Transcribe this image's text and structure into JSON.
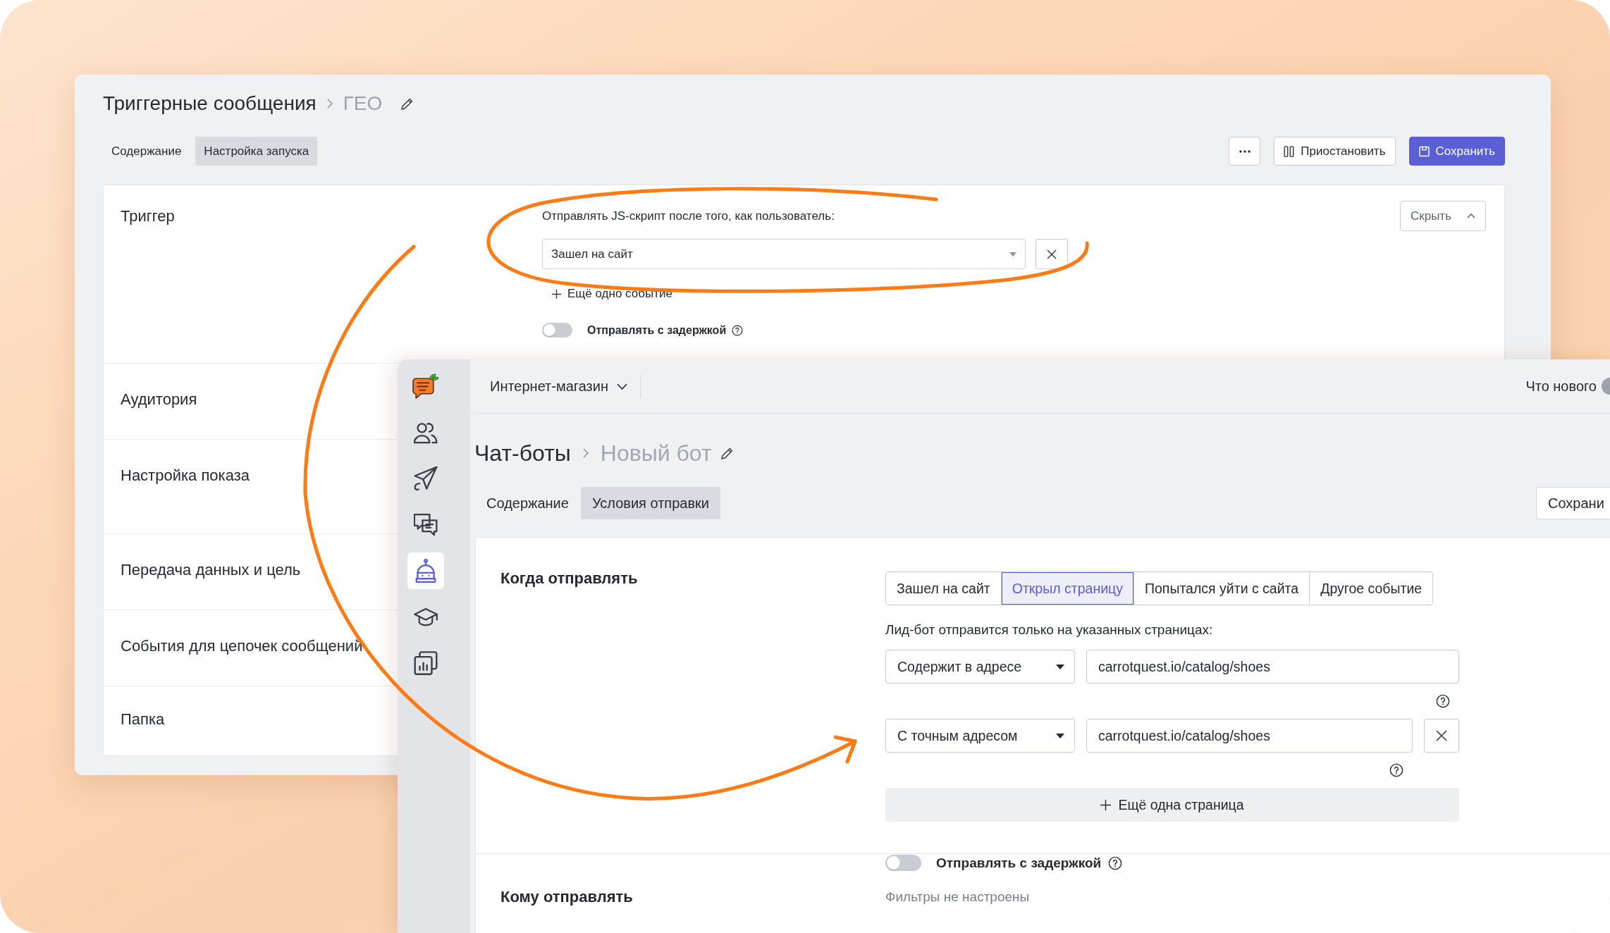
{
  "back_window": {
    "breadcrumb": {
      "parent": "Триггерные сообщения",
      "current": "ГЕО"
    },
    "tabs": [
      {
        "label": "Содержание",
        "selected": false
      },
      {
        "label": "Настройка запуска",
        "selected": true
      }
    ],
    "actions": [
      {
        "kind": "more"
      },
      {
        "kind": "pause",
        "label": "Приостановить"
      },
      {
        "kind": "save",
        "label": "Сохранить"
      }
    ],
    "sections": [
      {
        "kind": "trigger",
        "title": "Триггер",
        "prompt": "Отправлять JS-скрипт после того, как пользователь:",
        "event": "Зашел на сайт",
        "add_event": "Ещё одно событие",
        "delay_toggle": {
          "label": "Отправлять с задержкой",
          "on": false
        },
        "hide_button": "Скрыть"
      },
      {
        "kind": "collapsed",
        "title": "Аудитория"
      },
      {
        "kind": "collapsed",
        "title": "Настройка показа"
      },
      {
        "kind": "collapsed",
        "title": "Передача данных и цель"
      },
      {
        "kind": "collapsed",
        "title": "События для цепочек сообщений"
      },
      {
        "kind": "collapsed",
        "title": "Папка"
      }
    ]
  },
  "front_window": {
    "sidebar": [
      {
        "kind": "users",
        "selected": false
      },
      {
        "kind": "send",
        "selected": false
      },
      {
        "kind": "chats",
        "selected": false
      },
      {
        "kind": "bots",
        "selected": true
      },
      {
        "kind": "learning",
        "selected": false
      },
      {
        "kind": "reports",
        "selected": false
      }
    ],
    "topbar": {
      "workspace": "Интернет-магазин",
      "whats_new": "Что нового"
    },
    "breadcrumb": {
      "parent": "Чат-боты",
      "current": "Новый бот"
    },
    "tabs": [
      {
        "label": "Содержание",
        "selected": false
      },
      {
        "label": "Условия отправки",
        "selected": true
      }
    ],
    "save_button": "Сохрани",
    "when": {
      "title": "Когда отправлять",
      "segments": [
        {
          "label": "Зашел на сайт",
          "selected": false
        },
        {
          "label": "Открыл страницу",
          "selected": true
        },
        {
          "label": "Попытался уйти с сайта",
          "selected": false
        },
        {
          "label": "Другое событие",
          "selected": false
        }
      ],
      "hint": "Лид-бот отправится только на указанных страницах:",
      "rules": [
        {
          "match": "Содержит в адресе",
          "url": "carrotquest.io/catalog/shoes",
          "removable": false
        },
        {
          "match": "С точным адресом",
          "url": "carrotquest.io/catalog/shoes",
          "removable": true
        }
      ],
      "add_page": "Ещё одна страница"
    },
    "delay_toggle": {
      "label": "Отправлять с задержкой",
      "on": false
    },
    "who": {
      "title": "Кому отправлять",
      "filters": "Фильтры не настроены"
    }
  }
}
